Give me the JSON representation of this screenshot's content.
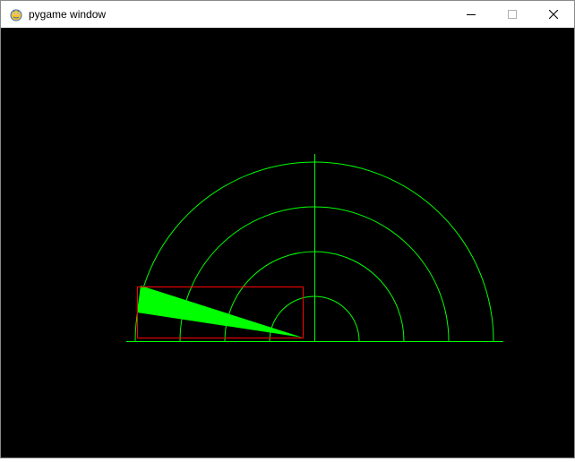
{
  "window": {
    "title": "pygame window",
    "icon": "pygame-snake-icon",
    "controls": {
      "minimize_icon": "minimize-icon",
      "maximize_icon": "maximize-icon",
      "close_icon": "close-icon"
    }
  },
  "scene": {
    "background_color": "#000000",
    "grid_color": "#00ff00",
    "sector_fill_color": "#00ff00",
    "bounding_rect_color": "#ff0000",
    "arc_count": 4,
    "description_shapes": [
      "semicircle-arcs",
      "baseline",
      "vertical-axis",
      "filled-sector",
      "bounding-rectangle"
    ]
  }
}
